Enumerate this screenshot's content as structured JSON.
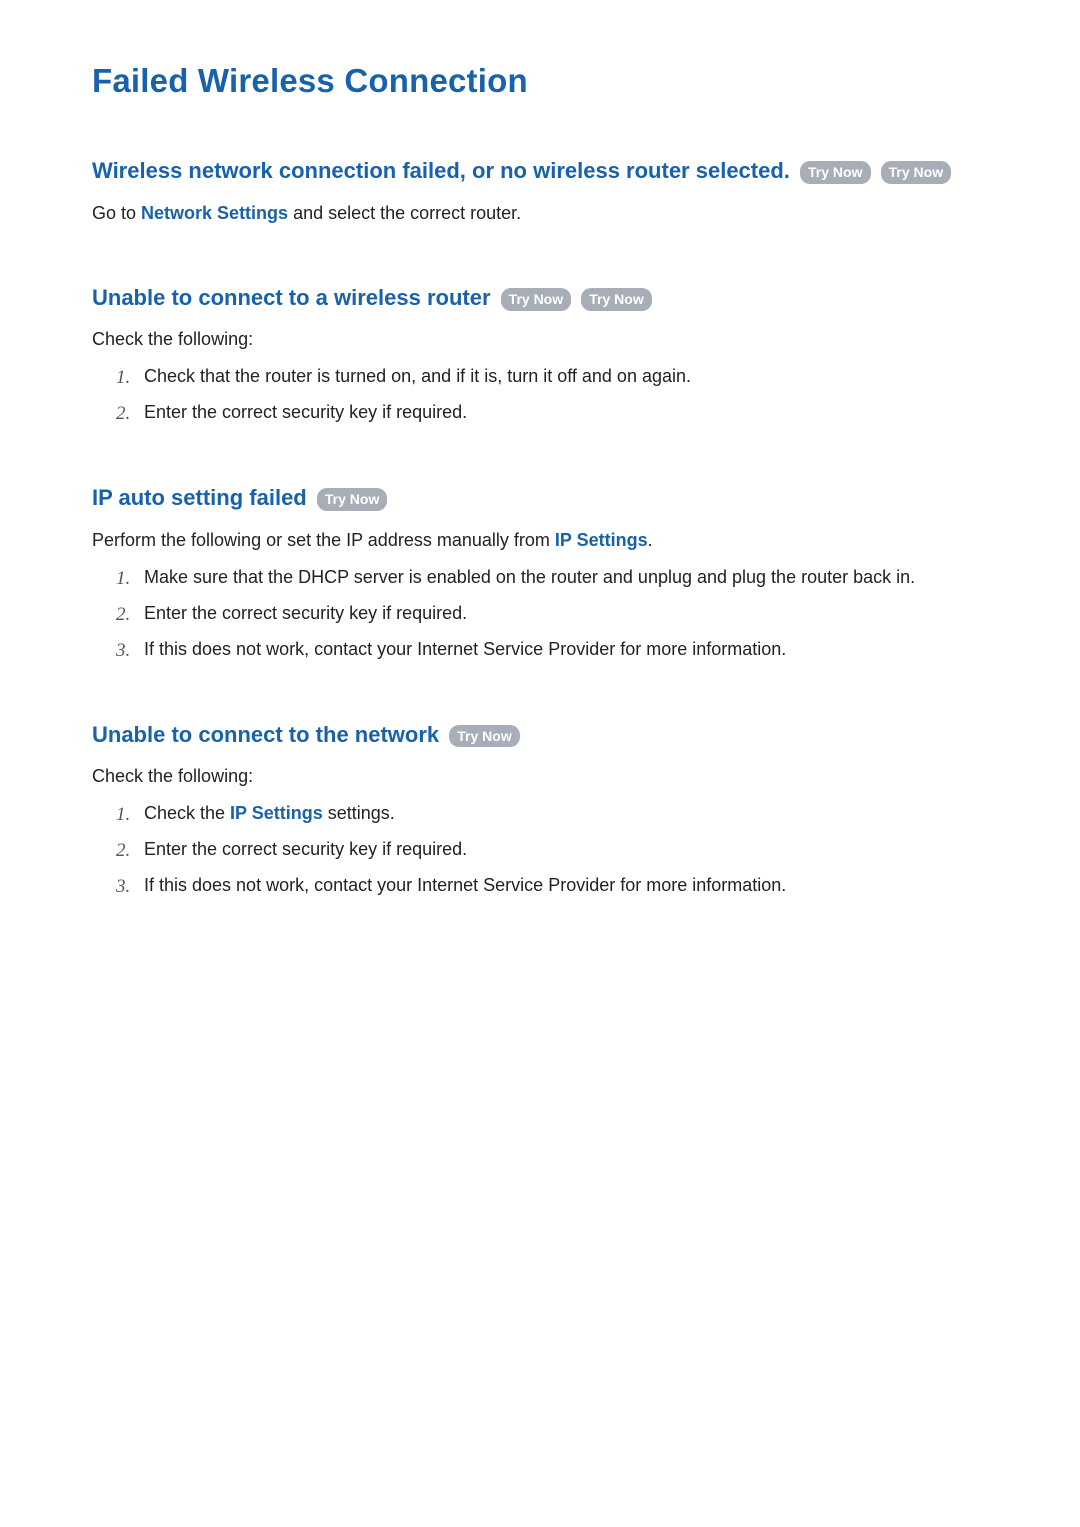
{
  "title": "Failed Wireless Connection",
  "try_now_label": "Try Now",
  "sections": {
    "s1": {
      "heading": "Wireless network connection failed, or no wireless router selected.",
      "body_prefix": "Go to ",
      "body_link": "Network Settings",
      "body_suffix": " and select the correct router."
    },
    "s2": {
      "heading": "Unable to connect to a wireless router",
      "intro": "Check the following:",
      "items": {
        "i1": "Check that the router is turned on, and if it is, turn it off and on again.",
        "i2": "Enter the correct security key if required."
      }
    },
    "s3": {
      "heading": "IP auto setting failed",
      "intro_prefix": "Perform the following or set the IP address manually from ",
      "intro_link": "IP Settings",
      "intro_suffix": ".",
      "items": {
        "i1": "Make sure that the DHCP server is enabled on the router and unplug and plug the router back in.",
        "i2": "Enter the correct security key if required.",
        "i3": "If this does not work, contact your Internet Service Provider for more information."
      }
    },
    "s4": {
      "heading": "Unable to connect to the network",
      "intro": "Check the following:",
      "items": {
        "i1_prefix": "Check the ",
        "i1_link": "IP Settings",
        "i1_suffix": " settings.",
        "i2": "Enter the correct security key if required.",
        "i3": "If this does not work, contact your Internet Service Provider for more information."
      }
    }
  },
  "numbers": {
    "n1": "1.",
    "n2": "2.",
    "n3": "3."
  }
}
